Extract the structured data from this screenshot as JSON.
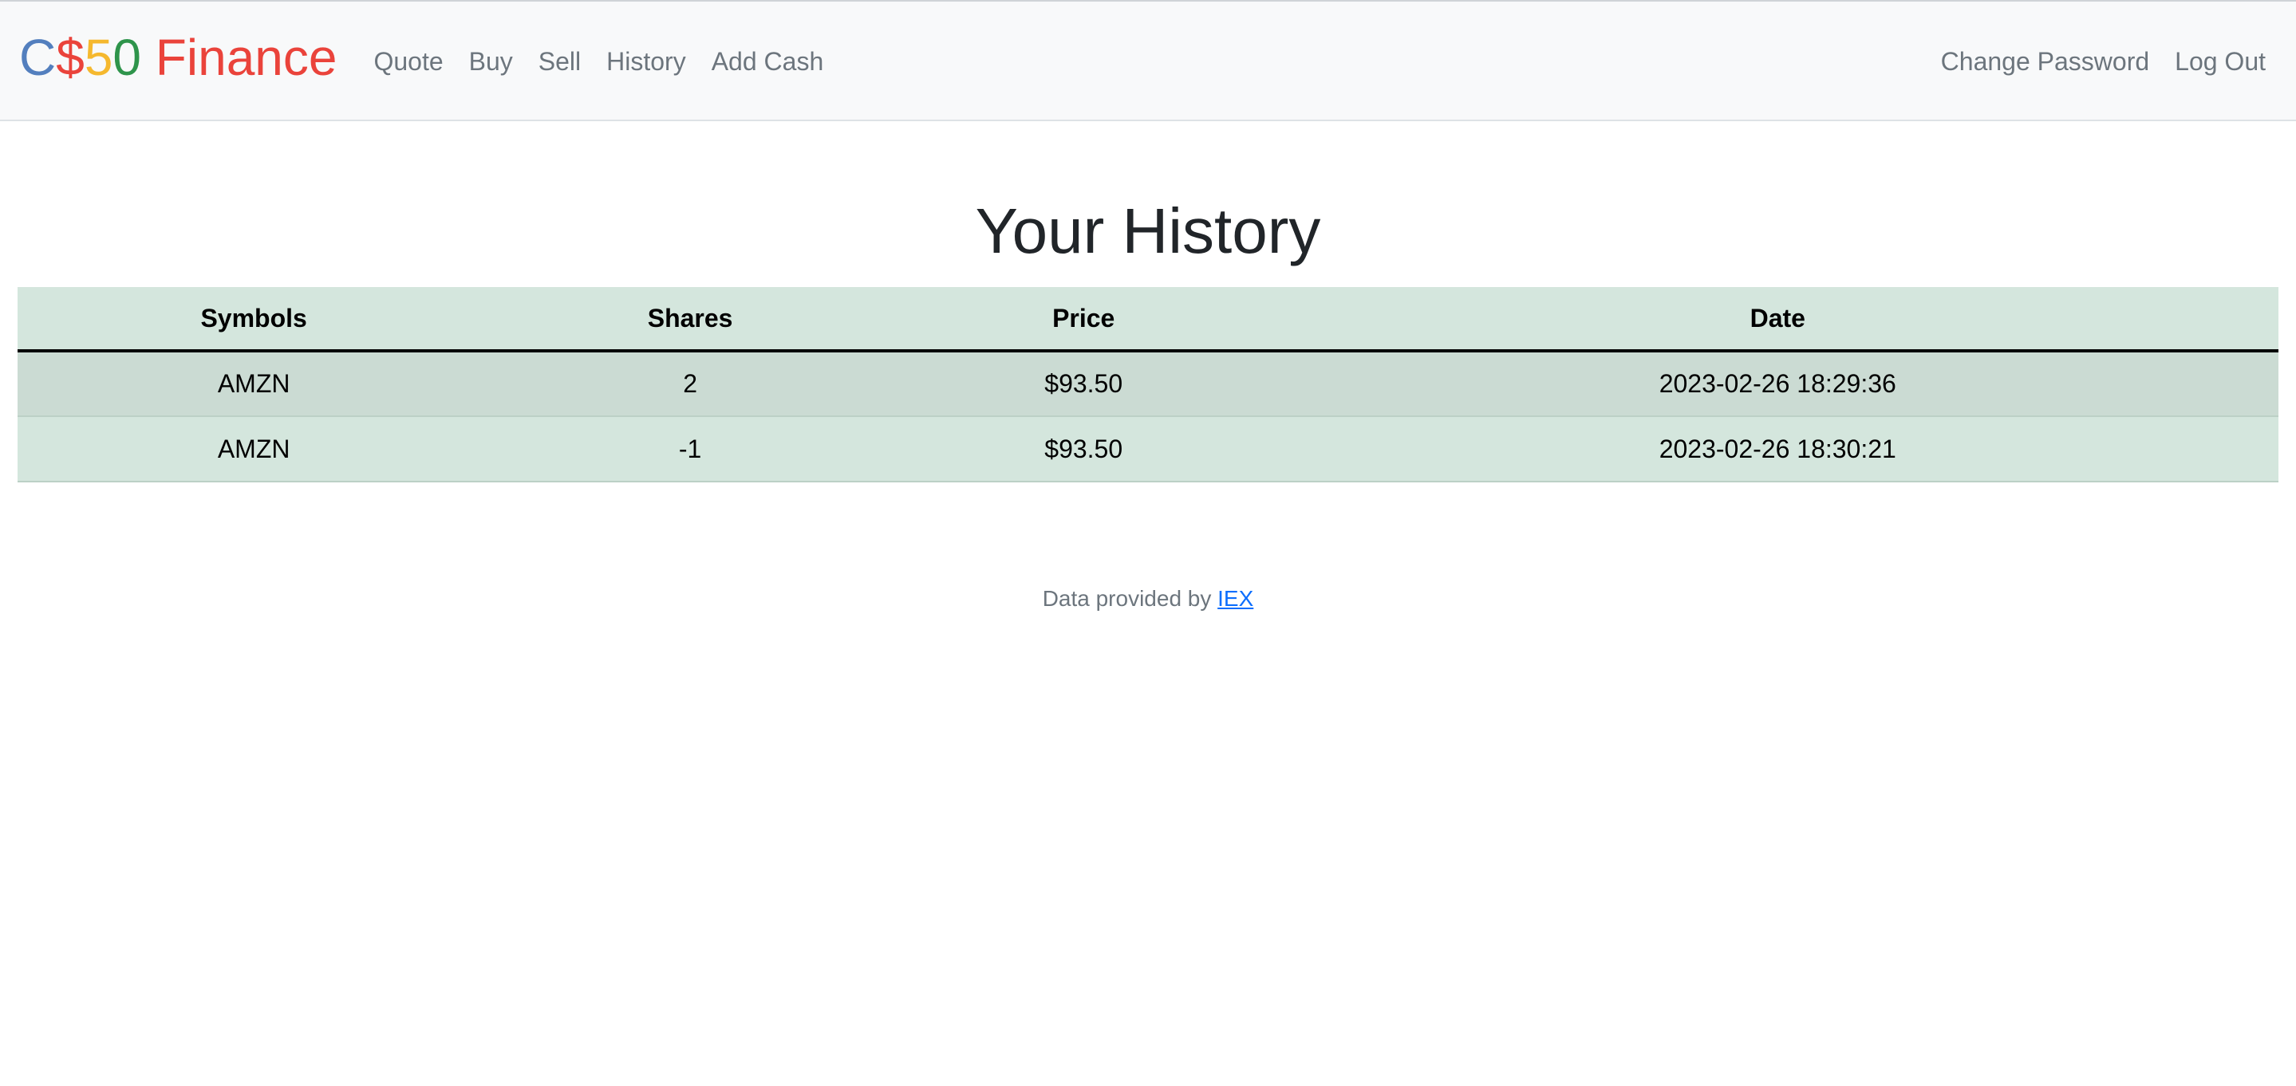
{
  "brand": {
    "letters": [
      {
        "text": "C",
        "color": "#537fbe"
      },
      {
        "text": "$",
        "color": "#ea433b"
      },
      {
        "text": "5",
        "color": "#f5b82e"
      },
      {
        "text": "0",
        "color": "#2e944b"
      },
      {
        "text": " Finance",
        "color": "#ea433b"
      }
    ]
  },
  "nav": {
    "left": [
      "Quote",
      "Buy",
      "Sell",
      "History",
      "Add Cash"
    ],
    "right": [
      "Change Password",
      "Log Out"
    ]
  },
  "page": {
    "title": "Your History"
  },
  "table": {
    "headers": [
      "Symbols",
      "Shares",
      "Price",
      "Date"
    ],
    "rows": [
      [
        "AMZN",
        "2",
        "$93.50",
        "2023-02-26 18:29:36"
      ],
      [
        "AMZN",
        "-1",
        "$93.50",
        "2023-02-26 18:30:21"
      ]
    ]
  },
  "footer": {
    "text": "Data provided by ",
    "link_label": "IEX"
  },
  "colors": {
    "table_bg": "#d4e6dd",
    "table_stripe": "#cbdbd3",
    "link": "#0d6efd"
  }
}
